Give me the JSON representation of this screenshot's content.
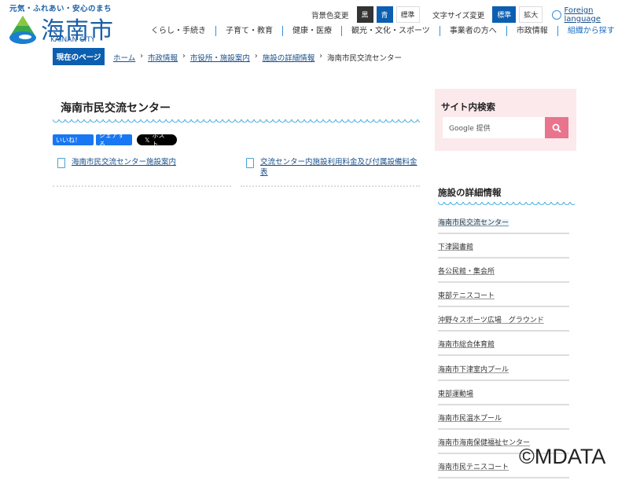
{
  "header": {
    "tagline": "元気・ふれあい・安心のまち",
    "logo_kanji": "海南市",
    "logo_en": "KAINAN CITY",
    "bg_label": "背景色変更",
    "bg_options": [
      "黒",
      "青",
      "標準"
    ],
    "size_label": "文字サイズ変更",
    "size_options": [
      "標準",
      "拡大"
    ],
    "foreign": "Foreign language"
  },
  "nav": [
    "くらし・手続き",
    "子育て・教育",
    "健康・医療",
    "観光・文化・スポーツ",
    "事業者の方へ",
    "市政情報",
    "組織から探す"
  ],
  "breadcrumb": {
    "label": "現在のページ",
    "items": [
      "ホーム",
      "市政情報",
      "市役所・施設案内",
      "施設の詳細情報"
    ],
    "current": "海南市民交流センター"
  },
  "main": {
    "title": "海南市民交流センター",
    "social": {
      "like": "いいね！",
      "share": "シェアする",
      "post": "ポスト"
    },
    "links": [
      "海南市民交流センター施設案内",
      "交流センター内施設利用料金及び付属設備料金表"
    ]
  },
  "sidebar": {
    "search_title": "サイト内検索",
    "search_placeholder": "Google 提供",
    "section_title": "施設の詳細情報",
    "items": [
      "海南市民交流センター",
      "下津図書館",
      "各公民館・集会所",
      "東部テニスコート",
      "沖野々スポーツ広場　グラウンド",
      "海南市総合体育館",
      "海南市下津室内プール",
      "東部運動場",
      "海南市民温水プール",
      "海南市海南保健福祉センター",
      "海南市民テニスコート"
    ]
  },
  "watermark": "©MDATA"
}
